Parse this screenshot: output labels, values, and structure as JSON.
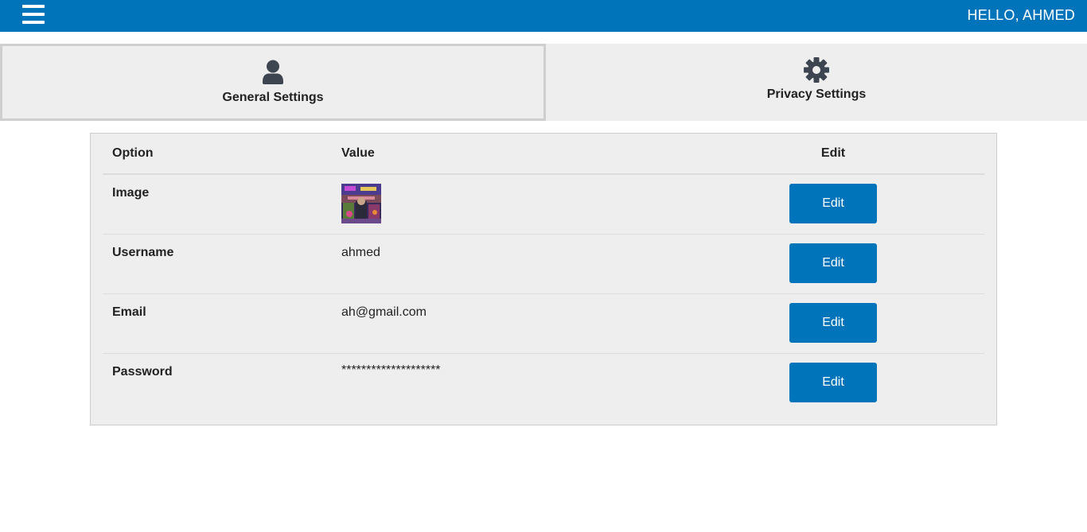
{
  "header": {
    "greeting": "HELLO, AHMED",
    "menu_icon": "hamburger-menu-icon",
    "bar_color": "#0074bb"
  },
  "tabs": [
    {
      "label": "General Settings",
      "icon": "user-icon",
      "active": true
    },
    {
      "label": "Privacy Settings",
      "icon": "gear-icon",
      "active": false
    }
  ],
  "table": {
    "columns": [
      "Option",
      "Value",
      "Edit"
    ],
    "rows": [
      {
        "option": "Image",
        "value": "",
        "value_type": "image",
        "edit_label": "Edit"
      },
      {
        "option": "Username",
        "value": "ahmed",
        "edit_label": "Edit"
      },
      {
        "option": "Email",
        "value": "ah@gmail.com",
        "edit_label": "Edit"
      },
      {
        "option": "Password",
        "value": "********************",
        "edit_label": "Edit"
      }
    ]
  },
  "colors": {
    "accent": "#0074bb",
    "panel_bg": "#eeeeee"
  }
}
